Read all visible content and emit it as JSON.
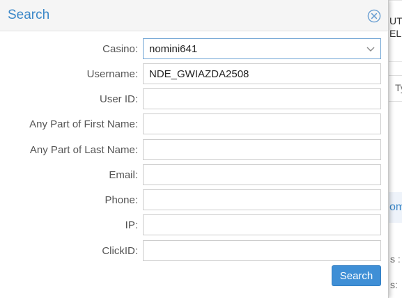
{
  "dialog": {
    "title": "Search",
    "close_icon": "close-circle-icon",
    "accent_color": "#3a87c8"
  },
  "form": {
    "casino": {
      "label": "Casino:",
      "value": "nomini641"
    },
    "username": {
      "label": "Username:",
      "value": "NDE_GWIAZDA2508"
    },
    "user_id": {
      "label": "User ID:",
      "value": ""
    },
    "first_name": {
      "label": "Any Part of First Name:",
      "value": ""
    },
    "last_name": {
      "label": "Any Part of Last Name:",
      "value": ""
    },
    "email": {
      "label": "Email:",
      "value": ""
    },
    "phone": {
      "label": "Phone:",
      "value": ""
    },
    "ip": {
      "label": "IP:",
      "value": ""
    },
    "click_id": {
      "label": "ClickID:",
      "value": ""
    },
    "submit_label": "Search",
    "button_color": "#3f8fd6"
  },
  "background": {
    "fragments": [
      "UT",
      "EL",
      "Ty",
      "om",
      "s :",
      "s:"
    ]
  }
}
